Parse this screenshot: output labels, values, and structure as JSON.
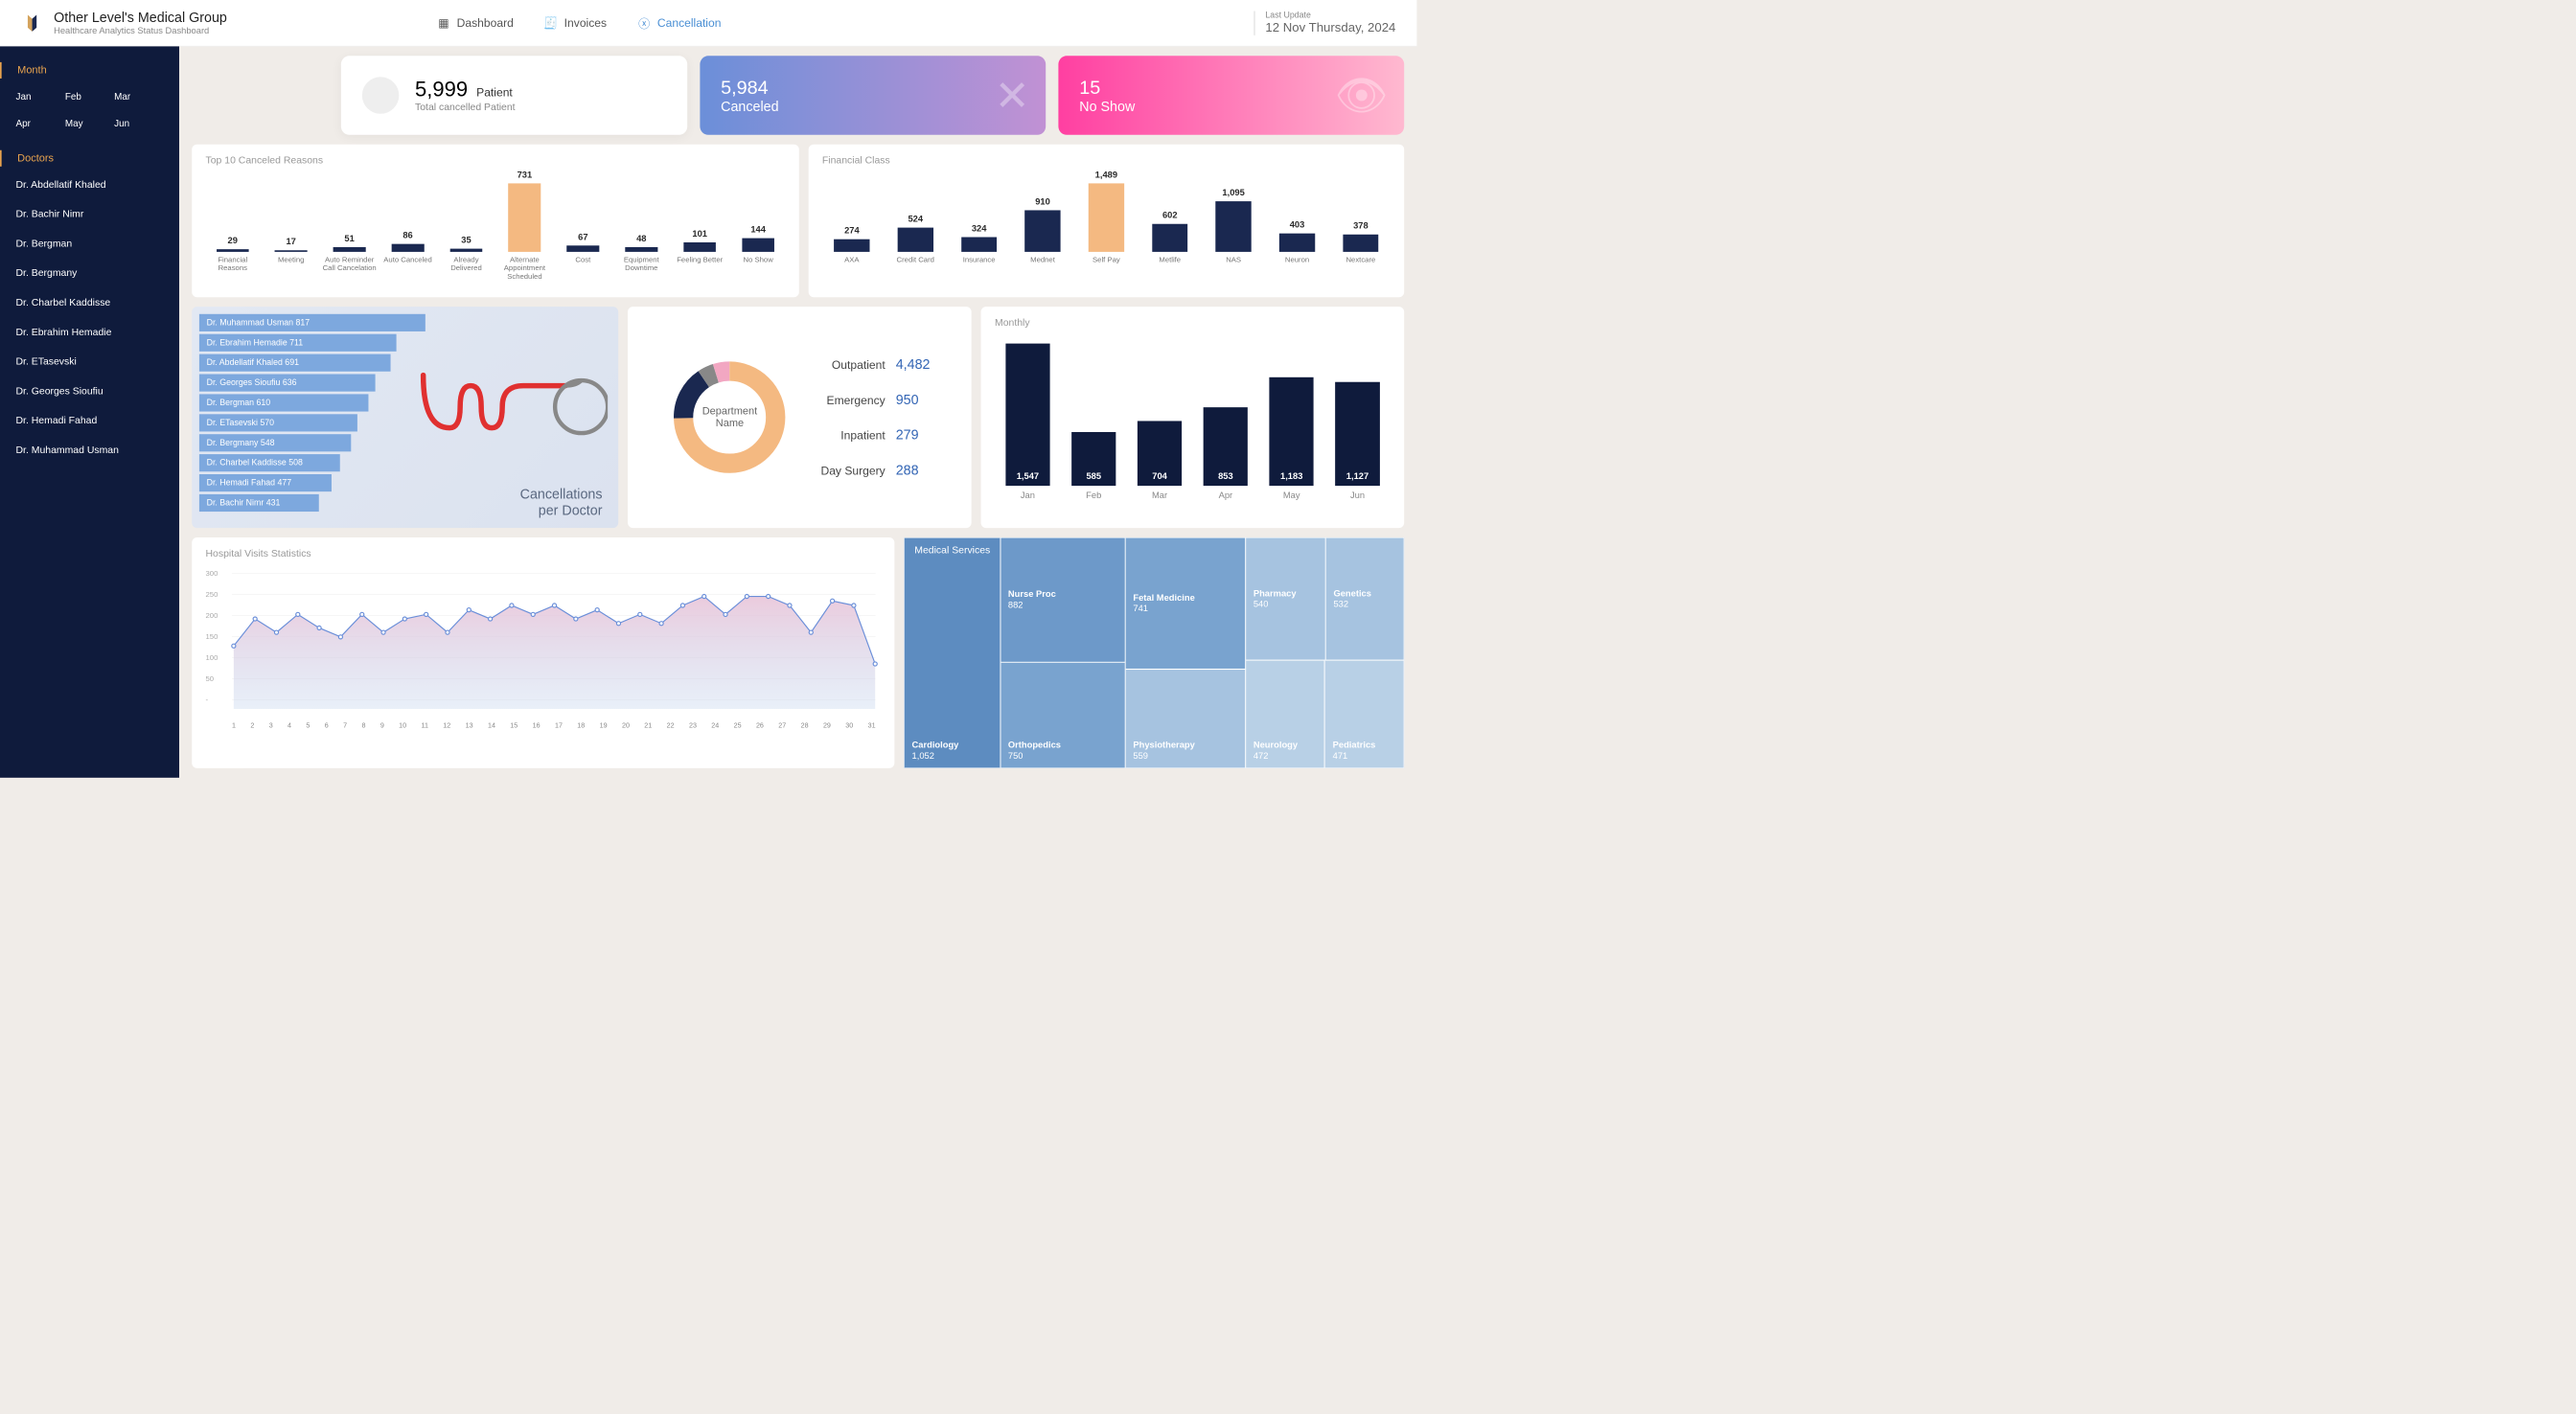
{
  "brand": {
    "title": "Other Level's Medical Group",
    "subtitle": "Healthcare Analytics Status Dashboard"
  },
  "tabs": [
    {
      "label": "Dashboard",
      "active": false
    },
    {
      "label": "Invoices",
      "active": false
    },
    {
      "label": "Cancellation",
      "active": true
    }
  ],
  "update": {
    "label": "Last Update",
    "date": "12 Nov Thursday, 2024"
  },
  "sidebar": {
    "month_title": "Month",
    "months": [
      "Jan",
      "Feb",
      "Mar",
      "Apr",
      "May",
      "Jun"
    ],
    "doctors_title": "Doctors",
    "doctors": [
      "Dr. Abdellatif Khaled",
      "Dr. Bachir Nimr",
      "Dr. Bergman",
      "Dr. Bergmany",
      "Dr. Charbel Kaddisse",
      "Dr. Ebrahim Hemadie",
      "Dr. ETasevski",
      "Dr. Georges Sioufiu",
      "Dr. Hemadi Fahad",
      "Dr. Muhammad Usman"
    ]
  },
  "kpi": {
    "total_num": "5,999",
    "total_unit": "Patient",
    "total_sub": "Total cancelled Patient",
    "canceled_num": "5,984",
    "canceled_lbl": "Canceled",
    "noshow_num": "15",
    "noshow_lbl": "No Show"
  },
  "reasons_title": "Top 10 Canceled Reasons",
  "finclass_title": "Financial Class",
  "perdoc_title": "Cancellations\nper Doctor",
  "dept": {
    "center1": "Department",
    "center2": "Name",
    "rows": [
      {
        "name": "Outpatient",
        "val": "4,482"
      },
      {
        "name": "Emergency",
        "val": "950"
      },
      {
        "name": "Inpatient",
        "val": "279"
      },
      {
        "name": "Day Surgery",
        "val": "288"
      }
    ]
  },
  "monthly_title": "Monthly",
  "visits_title": "Hospital Visits Statistics",
  "tree_title": "Medical Services",
  "chart_data": {
    "reasons": {
      "type": "bar",
      "categories": [
        "Financial Reasons",
        "Meeting",
        "Auto Reminder Call Cancelation",
        "Auto Canceled",
        "Already Delivered",
        "Alternate Appointment Scheduled",
        "Cost",
        "Equipment Downtime",
        "Feeling Better",
        "No Show"
      ],
      "values": [
        29,
        17,
        51,
        86,
        35,
        731,
        67,
        48,
        101,
        144
      ],
      "highlight_index": 5
    },
    "finclass": {
      "type": "bar",
      "categories": [
        "AXA",
        "Credit Card",
        "Insurance",
        "Mednet",
        "Self Pay",
        "Metlife",
        "NAS",
        "Neuron",
        "Nextcare"
      ],
      "values": [
        274,
        524,
        324,
        910,
        1489,
        602,
        1095,
        403,
        378
      ],
      "highlight_index": 4
    },
    "per_doctor": {
      "type": "bar_horizontal",
      "series": [
        {
          "name": "Dr. Muhammad Usman",
          "value": 817
        },
        {
          "name": "Dr. Ebrahim Hemadie",
          "value": 711
        },
        {
          "name": "Dr. Abdellatif Khaled",
          "value": 691
        },
        {
          "name": "Dr. Georges Sioufiu",
          "value": 636
        },
        {
          "name": "Dr. Bergman",
          "value": 610
        },
        {
          "name": "Dr. ETasevski",
          "value": 570
        },
        {
          "name": "Dr. Bergmany",
          "value": 548
        },
        {
          "name": "Dr. Charbel Kaddisse",
          "value": 508
        },
        {
          "name": "Dr. Hemadi Fahad",
          "value": 477
        },
        {
          "name": "Dr. Bachir Nimr",
          "value": 431
        }
      ]
    },
    "department_donut": {
      "type": "pie",
      "series": [
        {
          "name": "Outpatient",
          "value": 4482,
          "color": "#f4b981"
        },
        {
          "name": "Emergency",
          "value": 950,
          "color": "#1a2850"
        },
        {
          "name": "Inpatient",
          "value": 279,
          "color": "#888"
        },
        {
          "name": "Day Surgery",
          "value": 288,
          "color": "#f2a7c2"
        }
      ]
    },
    "monthly": {
      "type": "bar",
      "categories": [
        "Jan",
        "Feb",
        "Mar",
        "Apr",
        "May",
        "Jun"
      ],
      "values": [
        1547,
        585,
        704,
        853,
        1183,
        1127
      ]
    },
    "visits": {
      "type": "area",
      "x": [
        1,
        2,
        3,
        4,
        5,
        6,
        7,
        8,
        9,
        10,
        11,
        12,
        13,
        14,
        15,
        16,
        17,
        18,
        19,
        20,
        21,
        22,
        23,
        24,
        25,
        26,
        27,
        28,
        29,
        30,
        31
      ],
      "values": [
        140,
        200,
        170,
        210,
        180,
        160,
        210,
        170,
        200,
        210,
        170,
        220,
        200,
        230,
        210,
        230,
        200,
        220,
        190,
        210,
        190,
        230,
        250,
        210,
        250,
        250,
        230,
        170,
        240,
        230,
        100
      ],
      "yticks": [
        0,
        50,
        100,
        150,
        200,
        250,
        300
      ],
      "ylim": [
        0,
        300
      ]
    },
    "treemap": {
      "type": "treemap",
      "series": [
        {
          "name": "Cardiology",
          "value": 1052,
          "color": "#5d8cc0"
        },
        {
          "name": "Nurse Proc",
          "value": 882,
          "color": "#6d99c9"
        },
        {
          "name": "Orthopedics",
          "value": 750,
          "color": "#79a3cf"
        },
        {
          "name": "Fetal Medicine",
          "value": 741,
          "color": "#79a3cf"
        },
        {
          "name": "Physiotherapy",
          "value": 559,
          "color": "#a6c3e0"
        },
        {
          "name": "Pharmacy",
          "value": 540,
          "color": "#a6c3e0"
        },
        {
          "name": "Genetics",
          "value": 532,
          "color": "#a6c3e0"
        },
        {
          "name": "Neurology",
          "value": 472,
          "color": "#b8d0e6"
        },
        {
          "name": "Pediatrics",
          "value": 471,
          "color": "#b8d0e6"
        }
      ]
    }
  }
}
